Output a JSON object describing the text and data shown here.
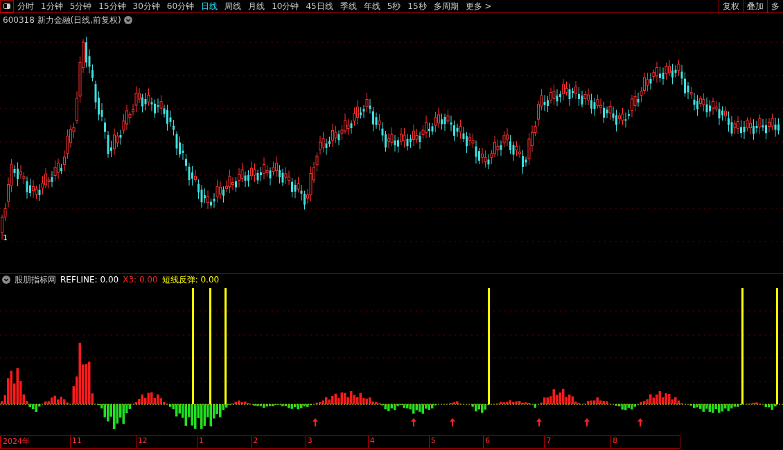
{
  "toolbar": {
    "periods": [
      {
        "label": "分时",
        "selected": false
      },
      {
        "label": "1分钟",
        "selected": false
      },
      {
        "label": "5分钟",
        "selected": false
      },
      {
        "label": "15分钟",
        "selected": false
      },
      {
        "label": "30分钟",
        "selected": false
      },
      {
        "label": "60分钟",
        "selected": false
      },
      {
        "label": "日线",
        "selected": true
      },
      {
        "label": "周线",
        "selected": false
      },
      {
        "label": "月线",
        "selected": false
      },
      {
        "label": "10分钟",
        "selected": false
      },
      {
        "label": "45日线",
        "selected": false
      },
      {
        "label": "季线",
        "selected": false
      },
      {
        "label": "年线",
        "selected": false
      },
      {
        "label": "5秒",
        "selected": false
      },
      {
        "label": "15秒",
        "selected": false
      },
      {
        "label": "多周期",
        "selected": false
      }
    ],
    "more": "更多 >",
    "right_buttons": [
      "复权",
      "叠加",
      "多"
    ]
  },
  "chart_title": "600318 新力金融(日线,前复权)",
  "price_marker": "1",
  "indicator": {
    "name": "股朋指标网",
    "values": [
      {
        "label": "REFLINE: 0.00",
        "color": "#ffffff"
      },
      {
        "label": "X3: 0.00",
        "color": "#ff2020"
      },
      {
        "label": "短线反弹: 0.00",
        "color": "#ffff00"
      }
    ]
  },
  "date_axis": [
    "2024年",
    "11",
    "12",
    "1",
    "2",
    "3",
    "4",
    "5",
    "6",
    "7",
    "8"
  ]
}
